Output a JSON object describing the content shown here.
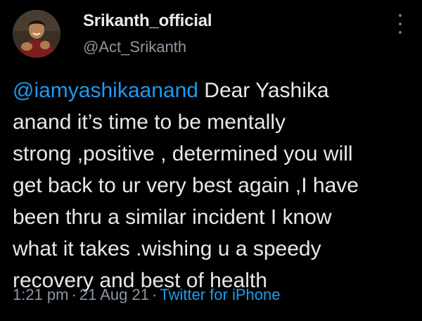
{
  "author": {
    "display_name": "Srikanth_official",
    "handle": "@Act_Srikanth",
    "avatar_icon": "profile-photo"
  },
  "tweet": {
    "mention": "@iamyashikaanand",
    "lines": [
      " Dear Yashika",
      "anand it’s time to be mentally",
      "strong ,positive , determined you will",
      "get back to ur very best again ,I have",
      "been thru a similar incident I know",
      "what it takes .wishing u a speedy",
      "recovery and best of health"
    ]
  },
  "meta": {
    "time": "1:21 pm",
    "separator": "·",
    "date": "21 Aug 21",
    "source": "Twitter for iPhone"
  },
  "colors": {
    "background": "#000000",
    "text": "#e7e9ea",
    "secondary": "#8b98a5",
    "link": "#1d9bf0"
  },
  "more_icon": "more-vertical-icon"
}
